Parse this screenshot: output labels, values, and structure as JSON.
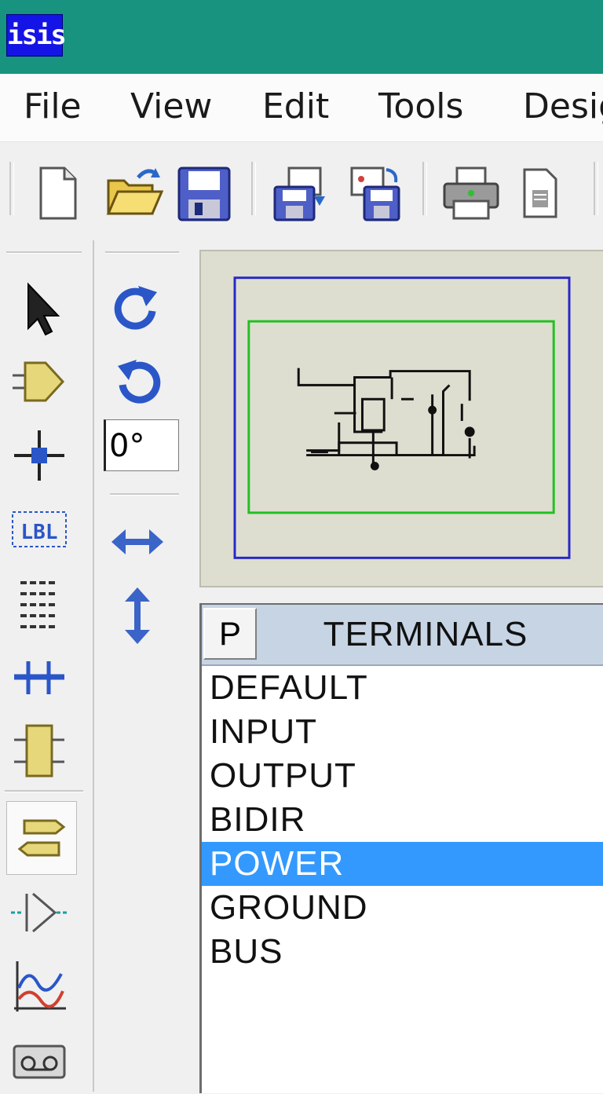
{
  "app": {
    "icon_text": "isis",
    "titlebar_color": "#17937f"
  },
  "menu": [
    {
      "label": "File"
    },
    {
      "label": "View"
    },
    {
      "label": "Edit"
    },
    {
      "label": "Tools"
    },
    {
      "label": "Desig"
    }
  ],
  "toolbar": {
    "icons": [
      "new-file-icon",
      "open-folder-icon",
      "save-icon",
      "save-as-icon",
      "save-template-icon",
      "print-icon",
      "print-area-icon"
    ]
  },
  "left_toolbar": {
    "icons": [
      "selection-arrow-icon",
      "component-mode-icon",
      "junction-dot-icon",
      "wire-label-icon",
      "text-script-icon",
      "bus-icon",
      "subcircuit-icon",
      "terminals-mode-icon",
      "device-pin-icon",
      "graph-mode-icon",
      "tape-recorder-icon"
    ],
    "active": "terminals-mode-icon"
  },
  "rotation": {
    "angle": "0°"
  },
  "device_panel": {
    "pick_label": "P",
    "title": "TERMINALS",
    "items": [
      "DEFAULT",
      "INPUT",
      "OUTPUT",
      "BIDIR",
      "POWER",
      "GROUND",
      "BUS"
    ],
    "selected_index": 4,
    "selection_color": "#3399ff"
  }
}
